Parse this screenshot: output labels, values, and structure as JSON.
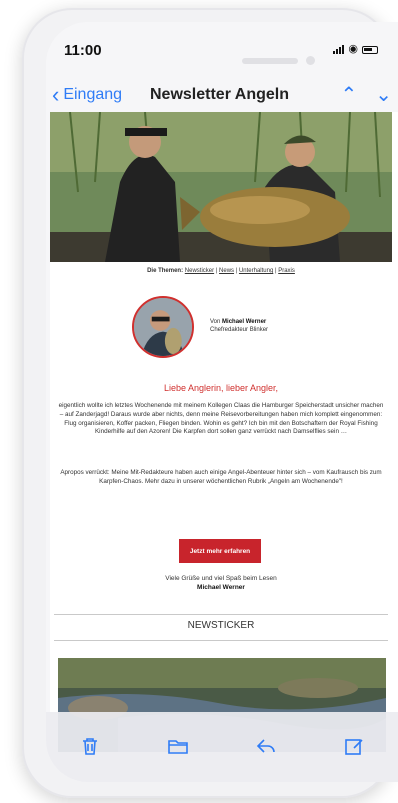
{
  "status": {
    "time": "11:00"
  },
  "nav": {
    "back_label": "Eingang",
    "title": "Newsletter Angeln"
  },
  "email": {
    "topics_prefix": "Die Themen:",
    "topics": [
      "Newsticker",
      "News",
      "Unterhaltung",
      "Praxis"
    ],
    "author_prefix": "Von",
    "author_name": "Michael Werner",
    "author_role": "Chefredakteur Blinker",
    "greeting": "Liebe Anglerin, lieber Angler,",
    "paragraph1": "eigentlich wollte ich letztes Wochenende mit meinem Kollegen Claas die Hamburger Speicherstadt unsicher machen – auf Zanderjagd! Daraus wurde aber nichts, denn meine Reisevorbereitungen haben mich komplett eingenommen: Flug organisieren, Koffer packen, Fliegen binden. Wohin es geht? Ich bin mit den Botschaftern der Royal Fishing Kinderhilfe auf den Azoren! Die Karpfen dort sollen ganz verrückt nach Damselflies sein …",
    "paragraph2": "Apropos verrückt: Meine Mit-Redakteure haben auch einige Angel-Abenteuer hinter sich – vom Kaufrausch bis zum Karpfen-Chaos. Mehr dazu in unserer wöchentlichen Rubrik „Angeln am Wochenende\"!",
    "cta_label": "Jetzt mehr erfahren",
    "closing": "Viele Grüße und viel Spaß beim Lesen",
    "closing_name": "Michael Werner",
    "section_title": "NEWSTICKER"
  },
  "colors": {
    "accent": "#2f7cf6",
    "brand_red": "#c8242c"
  }
}
